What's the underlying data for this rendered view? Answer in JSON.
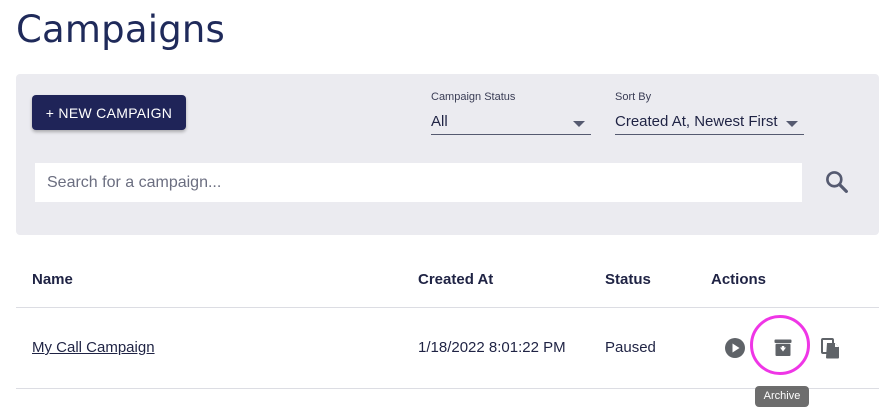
{
  "page": {
    "title": "Campaigns"
  },
  "toolbar": {
    "new_campaign_label": "+ NEW CAMPAIGN",
    "status_filter": {
      "label": "Campaign Status",
      "value": "All"
    },
    "sort_filter": {
      "label": "Sort By",
      "value": "Created At, Newest First"
    },
    "search": {
      "placeholder": "Search for a campaign...",
      "value": ""
    }
  },
  "table": {
    "headers": {
      "name": "Name",
      "created_at": "Created At",
      "status": "Status",
      "actions": "Actions"
    },
    "rows": [
      {
        "name": "My Call Campaign",
        "created_at": "1/18/2022 8:01:22 PM",
        "status": "Paused"
      }
    ]
  },
  "row_actions": {
    "icons": [
      "play-icon",
      "archive-icon",
      "copy-icon"
    ],
    "tooltip": "Archive"
  },
  "colors": {
    "primary": "#1f2458",
    "panel_bg": "#ebebf0",
    "highlight": "#ef36e6",
    "icon": "#5f6368"
  }
}
